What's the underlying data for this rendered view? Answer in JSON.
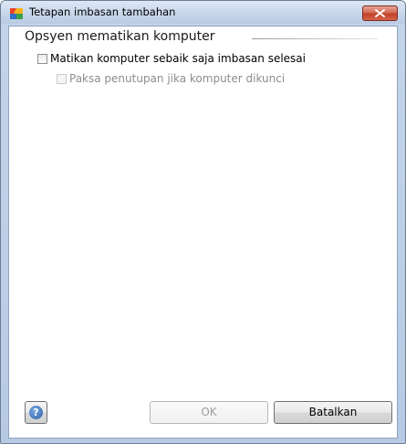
{
  "window": {
    "title": "Tetapan imbasan tambahan"
  },
  "group": {
    "title": "Opsyen mematikan komputer"
  },
  "options": [
    {
      "label": "Matikan komputer sebaik saja imbasan selesai",
      "checked": false,
      "enabled": true
    },
    {
      "label": "Paksa penutupan jika komputer dikunci",
      "checked": false,
      "enabled": false
    }
  ],
  "buttons": {
    "help_label": "?",
    "ok_label": "OK",
    "cancel_label": "Batalkan"
  },
  "icons": {
    "app": "avg-logo-icon",
    "close": "close-icon",
    "help": "help-icon"
  }
}
